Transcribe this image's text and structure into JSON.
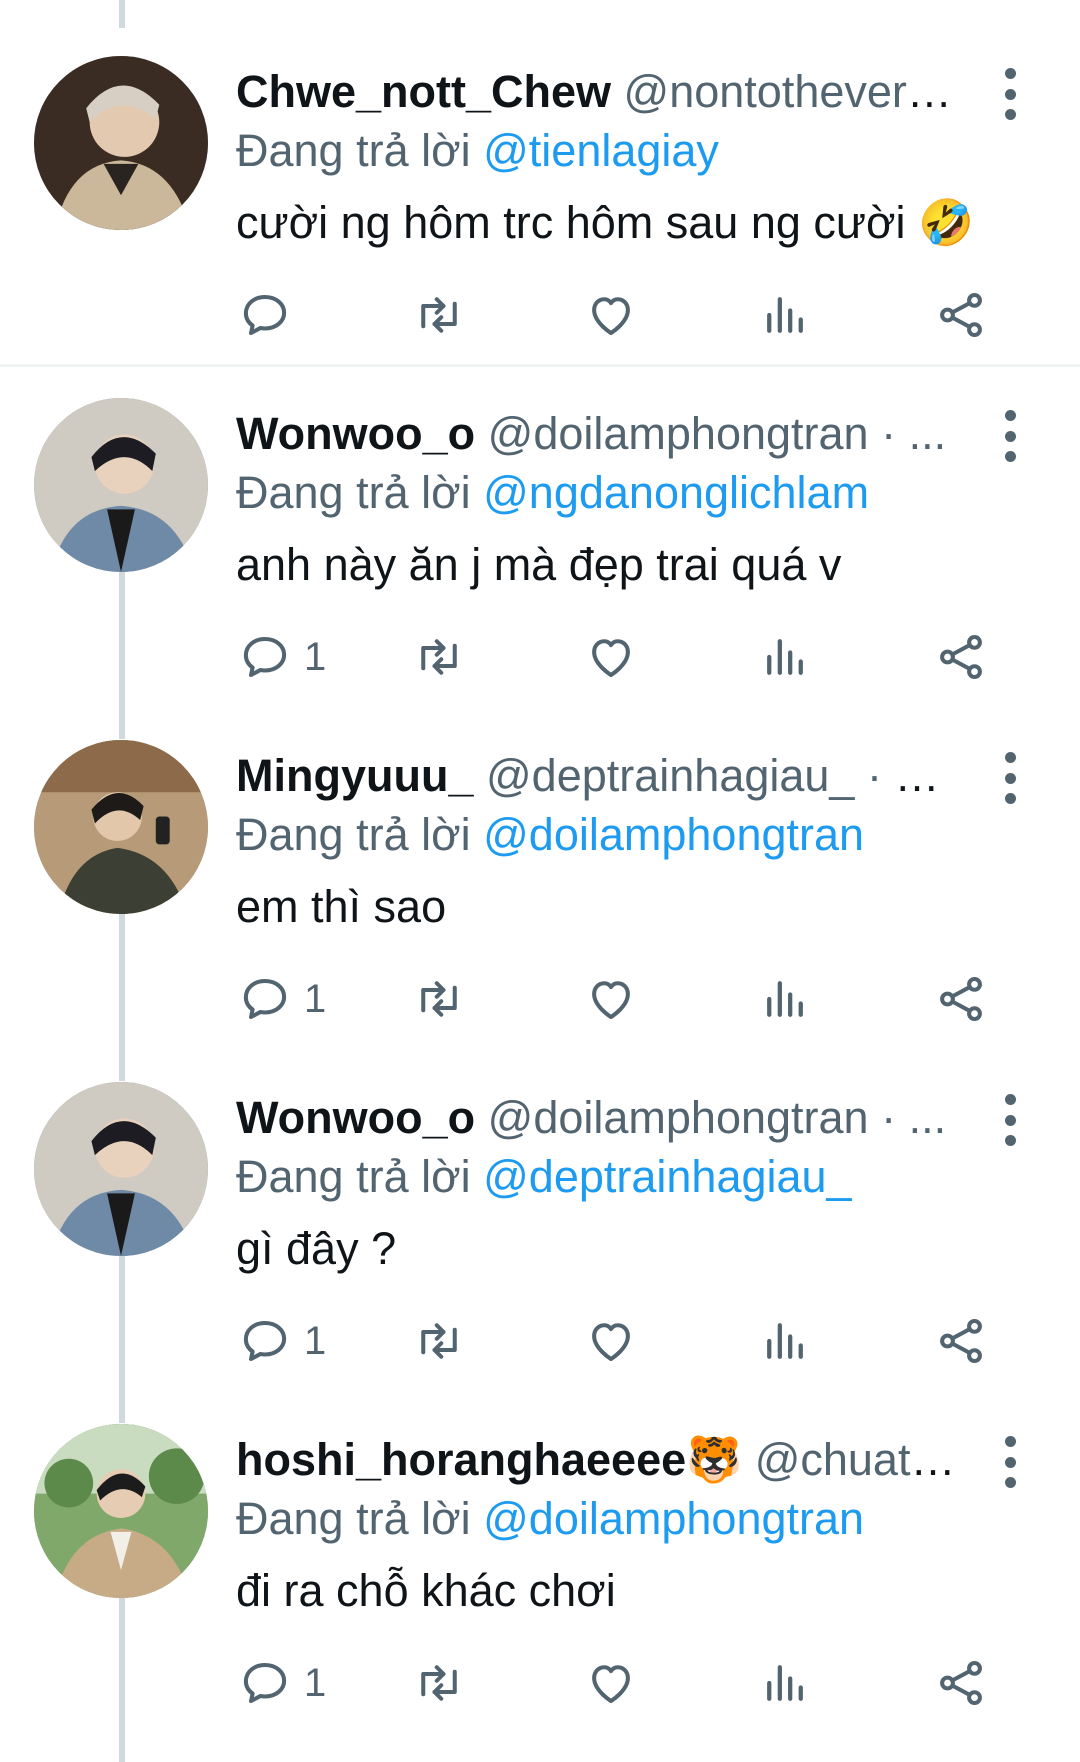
{
  "reply_prefix": "Đang trả lời",
  "icons": {
    "reply": "speech-bubble-icon",
    "retweet": "retweet-icon",
    "like": "heart-icon",
    "views": "bar-chart-icon",
    "share": "share-icon",
    "more": "vertical-ellipsis-icon"
  },
  "colors": {
    "mention": "#1d9bf0",
    "muted": "#536471",
    "text": "#0f1419"
  },
  "tweets": [
    {
      "name": "Chwe_nott_Chew",
      "handle": "@nontothever_...",
      "reply_to": "@tienlagiay",
      "text": "cười ng hôm trc hôm sau ng cười 🤣",
      "reply_count": ""
    },
    {
      "name": "Wonwoo_o",
      "handle": "@doilamphongtran · ...",
      "reply_to": "@ngdanonglichlam",
      "text": "anh này ăn j mà đẹp trai quá v",
      "reply_count": "1"
    },
    {
      "name": "Mingyuuu_",
      "handle": "@deptrainhagiau_ · 5m",
      "reply_to": "@doilamphongtran",
      "text": "em thì sao",
      "reply_count": "1"
    },
    {
      "name": "Wonwoo_o",
      "handle": "@doilamphongtran · ...",
      "reply_to": "@deptrainhagiau_",
      "text": "gì đây ?",
      "reply_count": "1"
    },
    {
      "name": "hoshi_horanghaeeee🐯",
      "handle": "@chuate...",
      "reply_to": "@doilamphongtran",
      "text": "đi ra chỗ khác chơi",
      "reply_count": "1"
    }
  ]
}
